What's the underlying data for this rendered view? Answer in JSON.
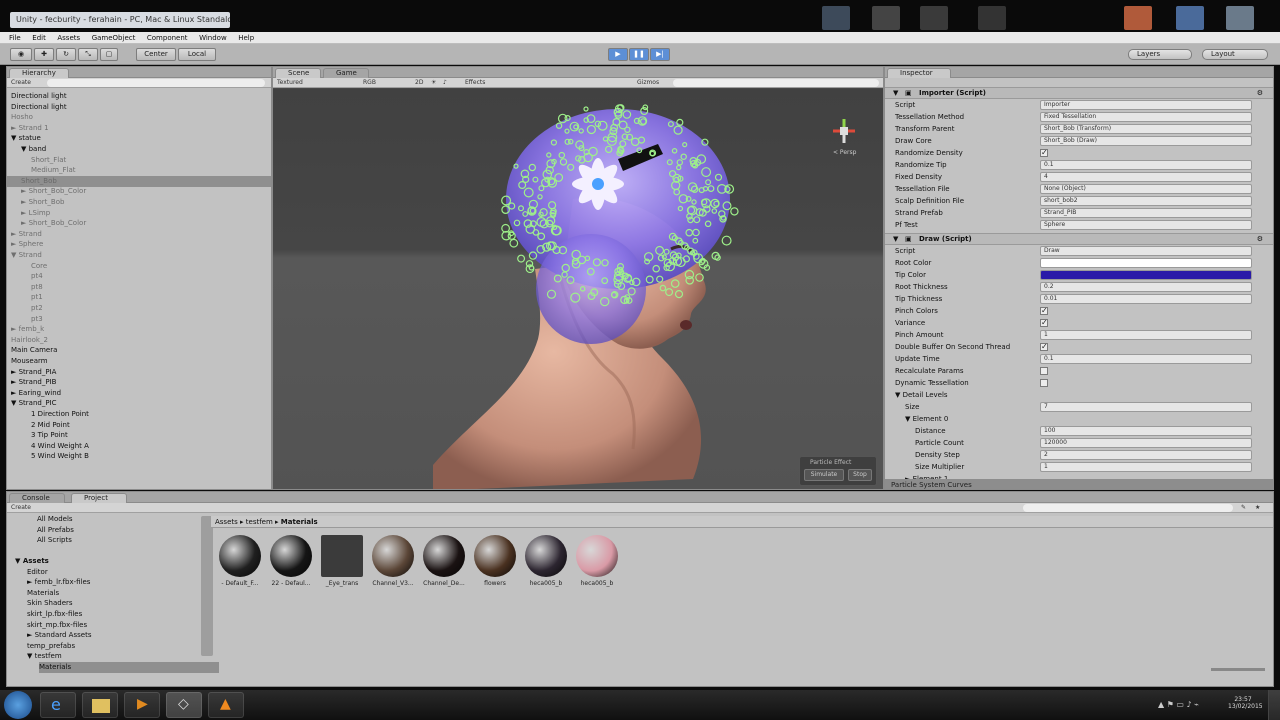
{
  "window": {
    "title": "Unity - fecburity - ferahain - PC, Mac & Linux Standalone"
  },
  "menu": [
    "File",
    "Edit",
    "Assets",
    "GameObject",
    "Component",
    "Window",
    "Help"
  ],
  "toolbar": {
    "pivot": "Center",
    "space": "Local",
    "layers": "Layers",
    "layout": "Layout"
  },
  "hierarchy": {
    "tab": "Hierarchy",
    "create": "Create",
    "items": [
      {
        "label": "Directional light",
        "indent": 0,
        "dim": false
      },
      {
        "label": "Directional light",
        "indent": 0,
        "dim": false
      },
      {
        "label": "Hosho",
        "indent": 0,
        "dim": true
      },
      {
        "label": "► Strand 1",
        "indent": 0,
        "dim": true
      },
      {
        "label": "▼ statue",
        "indent": 0,
        "dim": false
      },
      {
        "label": "▼ band",
        "indent": 1,
        "dim": false
      },
      {
        "label": "Short_Flat",
        "indent": 2,
        "dim": true
      },
      {
        "label": "Medium_Flat",
        "indent": 2,
        "dim": true
      },
      {
        "label": "Short_Bob",
        "indent": 1,
        "dim": true,
        "selected": true
      },
      {
        "label": "► Short_Bob_Color",
        "indent": 1,
        "dim": true
      },
      {
        "label": "► Short_Bob",
        "indent": 1,
        "dim": true
      },
      {
        "label": "► LSimp",
        "indent": 1,
        "dim": true
      },
      {
        "label": "► Short_Bob_Color",
        "indent": 1,
        "dim": true
      },
      {
        "label": "► Strand",
        "indent": 0,
        "dim": true
      },
      {
        "label": "► Sphere",
        "indent": 0,
        "dim": true
      },
      {
        "label": "▼ Strand",
        "indent": 0,
        "dim": true
      },
      {
        "label": "Core",
        "indent": 2,
        "dim": true
      },
      {
        "label": "pt4",
        "indent": 2,
        "dim": true
      },
      {
        "label": "pt8",
        "indent": 2,
        "dim": true
      },
      {
        "label": "pt1",
        "indent": 2,
        "dim": true
      },
      {
        "label": "pt2",
        "indent": 2,
        "dim": true
      },
      {
        "label": "pt3",
        "indent": 2,
        "dim": true
      },
      {
        "label": "► femb_k",
        "indent": 0,
        "dim": true
      },
      {
        "label": "Hairlook_2",
        "indent": 0,
        "dim": true
      },
      {
        "label": "Main Camera",
        "indent": 0,
        "dim": false
      },
      {
        "label": "Mousearm",
        "indent": 0,
        "dim": false
      },
      {
        "label": "► Strand_PIA",
        "indent": 0,
        "dim": false
      },
      {
        "label": "► Strand_PIB",
        "indent": 0,
        "dim": false
      },
      {
        "label": "► Earing_wind",
        "indent": 0,
        "dim": false
      },
      {
        "label": "▼ Strand_PIC",
        "indent": 0,
        "dim": false
      },
      {
        "label": "1 Direction Point",
        "indent": 2,
        "dim": false
      },
      {
        "label": "2 Mid Point",
        "indent": 2,
        "dim": false
      },
      {
        "label": "3 Tip Point",
        "indent": 2,
        "dim": false
      },
      {
        "label": "4 Wind Weight A",
        "indent": 2,
        "dim": false
      },
      {
        "label": "5 Wind Weight B",
        "indent": 2,
        "dim": false
      }
    ]
  },
  "scene": {
    "tabs": [
      "Scene",
      "Game"
    ],
    "shading": "Textured",
    "render": "RGB",
    "mode": "2D",
    "effects": "Effects",
    "gizmos": "Gizmos",
    "gizmo_label": "< Persp",
    "particle_panel": {
      "title": "Particle Effect",
      "simulate": "Simulate",
      "stop": "Stop"
    }
  },
  "inspector": {
    "tab": "Inspector",
    "importer_header": "Importer (Script)",
    "importer": [
      {
        "label": "Script",
        "value": "Importer"
      },
      {
        "label": "Tessellation Method",
        "value": "Fixed Tessellation"
      },
      {
        "label": "Transform Parent",
        "value": "Short_Bob (Transform)"
      },
      {
        "label": "Draw Core",
        "value": "Short_Bob (Draw)"
      },
      {
        "label": "Randomize Density",
        "value": "✓"
      },
      {
        "label": "Randomize Tip",
        "value": "0.1"
      },
      {
        "label": "Fixed Density",
        "value": "4"
      },
      {
        "label": "Tessellation File",
        "value": "None (Object)"
      },
      {
        "label": "Scalp Definition File",
        "value": "short_bob2"
      },
      {
        "label": "Strand Prefab",
        "value": "Strand_PIB"
      },
      {
        "label": "Pf Test",
        "value": "Sphere"
      }
    ],
    "draw_header": "Draw (Script)",
    "draw": [
      {
        "label": "Script",
        "value": "Draw"
      },
      {
        "label": "Root Color",
        "value": ""
      },
      {
        "label": "Tip Color",
        "value": ""
      },
      {
        "label": "Root Thickness",
        "value": "0.2"
      },
      {
        "label": "Tip Thickness",
        "value": "0.01"
      },
      {
        "label": "Pinch Colors",
        "value": "✓"
      },
      {
        "label": "Variance",
        "value": "✓"
      },
      {
        "label": "Pinch Amount",
        "value": "1"
      },
      {
        "label": "Double Buffer On Second Thread",
        "value": "✓"
      },
      {
        "label": "Update Time",
        "value": "0.1"
      },
      {
        "label": "Recalculate Params",
        "value": ""
      },
      {
        "label": "Dynamic Tessellation",
        "value": ""
      },
      {
        "label": "▼ Detail Levels",
        "value": ""
      },
      {
        "label": "Size",
        "value": "7"
      },
      {
        "label": "▼ Element 0",
        "value": ""
      },
      {
        "label": "Distance",
        "value": "100"
      },
      {
        "label": "Particle Count",
        "value": "120000"
      },
      {
        "label": "Density Step",
        "value": "2"
      },
      {
        "label": "Size Multiplier",
        "value": "1"
      },
      {
        "label": "► Element 1",
        "value": ""
      }
    ],
    "footer": "Particle System Curves",
    "colors": {
      "root": "#ffffff",
      "tip": "#2a1aa8"
    }
  },
  "project": {
    "tabs": [
      "Console",
      "Project"
    ],
    "create": "Create",
    "favorites": [
      "All Models",
      "All Prefabs",
      "All Scripts"
    ],
    "tree": [
      {
        "label": "▼ Assets",
        "indent": 0,
        "bold": true
      },
      {
        "label": "Editor",
        "indent": 1
      },
      {
        "label": "► femb_lr.fbx-files",
        "indent": 1
      },
      {
        "label": "Materials",
        "indent": 1
      },
      {
        "label": "Skin Shaders",
        "indent": 1
      },
      {
        "label": "skirt_lp.fbx-files",
        "indent": 1
      },
      {
        "label": "skirt_mp.fbx-files",
        "indent": 1
      },
      {
        "label": "► Standard Assets",
        "indent": 1
      },
      {
        "label": "temp_prefabs",
        "indent": 1
      },
      {
        "label": "▼ testfem",
        "indent": 1
      },
      {
        "label": "Materials",
        "indent": 2,
        "selected": true
      }
    ],
    "breadcrumb": [
      "Assets",
      "testfem",
      "Materials"
    ],
    "assets": [
      {
        "label": "- Default_F...",
        "color": "#1f1f1f"
      },
      {
        "label": "22 - Defaul...",
        "color": "#151515"
      },
      {
        "label": "_Eye_trans",
        "color": "#3b3b3b"
      },
      {
        "label": "Channel_V3...",
        "color": "#5b4637"
      },
      {
        "label": "Channel_De...",
        "color": "#1a1212"
      },
      {
        "label": "flowers",
        "color": "#4a3120"
      },
      {
        "label": "heca005_b",
        "color": "#2c2530"
      },
      {
        "label": "heca005_b",
        "color": "#d99aa6"
      }
    ]
  },
  "taskbar": {
    "clock_time": "23:57",
    "clock_date": "13/02/2015"
  }
}
